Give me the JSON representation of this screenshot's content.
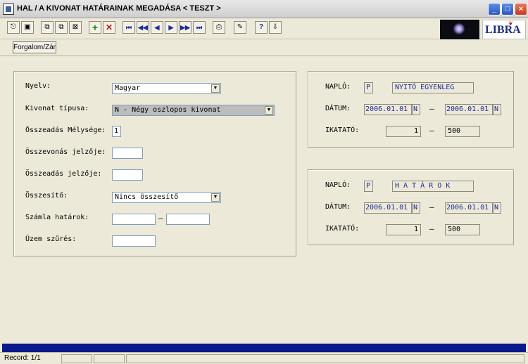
{
  "window": {
    "title": "HAL / A KIVONAT HATÁRAINAK MEGADÁSA  < TESZT >",
    "min_symbol": "_",
    "max_symbol": "□",
    "close_symbol": "×"
  },
  "toolbar": {
    "icons": [
      "exit-icon",
      "save-icon",
      "query-icon",
      "query-all-icon",
      "clear-icon",
      "insert-icon",
      "delete-icon",
      "first-record-icon",
      "previous-set-icon",
      "previous-record-icon",
      "next-record-icon",
      "next-set-icon",
      "last-record-icon",
      "print-icon",
      "edit-icon",
      "help-icon",
      "download-icon"
    ],
    "add_symbol": "+",
    "delete_symbol": "✕",
    "nav": [
      "⏮",
      "◀◀",
      "◀",
      "▶",
      "▶▶",
      "⏭"
    ],
    "help_symbol": "?",
    "down_symbol": "⇩",
    "logo_text": "LIBRA"
  },
  "subbar": {
    "button_label": "Forgalom/Zár"
  },
  "left_panel": {
    "nyelv_label": "Nyelv:",
    "nyelv_value": "Magyar",
    "kivonat_label": "Kivonat típusa:",
    "kivonat_value": "N - Négy oszlopos kivonat",
    "melyseg_label": "Összeadás Mélysége:",
    "melyseg_value": "1",
    "osszevonas_label": "Összevonás jelzője:",
    "osszevonas_value": "",
    "osszeadas_label": "Összeadás jelzője:",
    "osszeadas_value": "",
    "osszesito_label": "Összesítő:",
    "osszesito_value": "Nincs összesítő",
    "szamla_label": "Számla határok:",
    "szamla_from": "",
    "szamla_to": "",
    "uzem_label": "Üzem szűrés:",
    "uzem_value": ""
  },
  "right_panel_1": {
    "naplo_label": "NAPLÓ:",
    "naplo_code": "P",
    "naplo_name": "NYITÓ EGYENLEG",
    "datum_label": "DÁTUM:",
    "datum_from": "2006.01.01",
    "datum_from_flag": "N",
    "datum_to": "2006.01.01",
    "datum_to_flag": "N",
    "ikatato_label": "IKATATÓ:",
    "ikatato_from": "1",
    "ikatato_to": "500",
    "dash": "–"
  },
  "right_panel_2": {
    "naplo_label": "NAPLÓ:",
    "naplo_code": "P",
    "naplo_name": "H A T Á R O K",
    "datum_label": "DÁTUM:",
    "datum_from": "2006.01.01",
    "datum_from_flag": "N",
    "datum_to": "2006.01.01",
    "datum_to_flag": "N",
    "ikatato_label": "IKATATÓ:",
    "ikatato_from": "1",
    "ikatato_to": "500",
    "dash": "–"
  },
  "status": {
    "record": "Record: 1/1"
  },
  "colors": {
    "field_text": "#1c2a9a",
    "status_bar": "#0a1a8a"
  }
}
